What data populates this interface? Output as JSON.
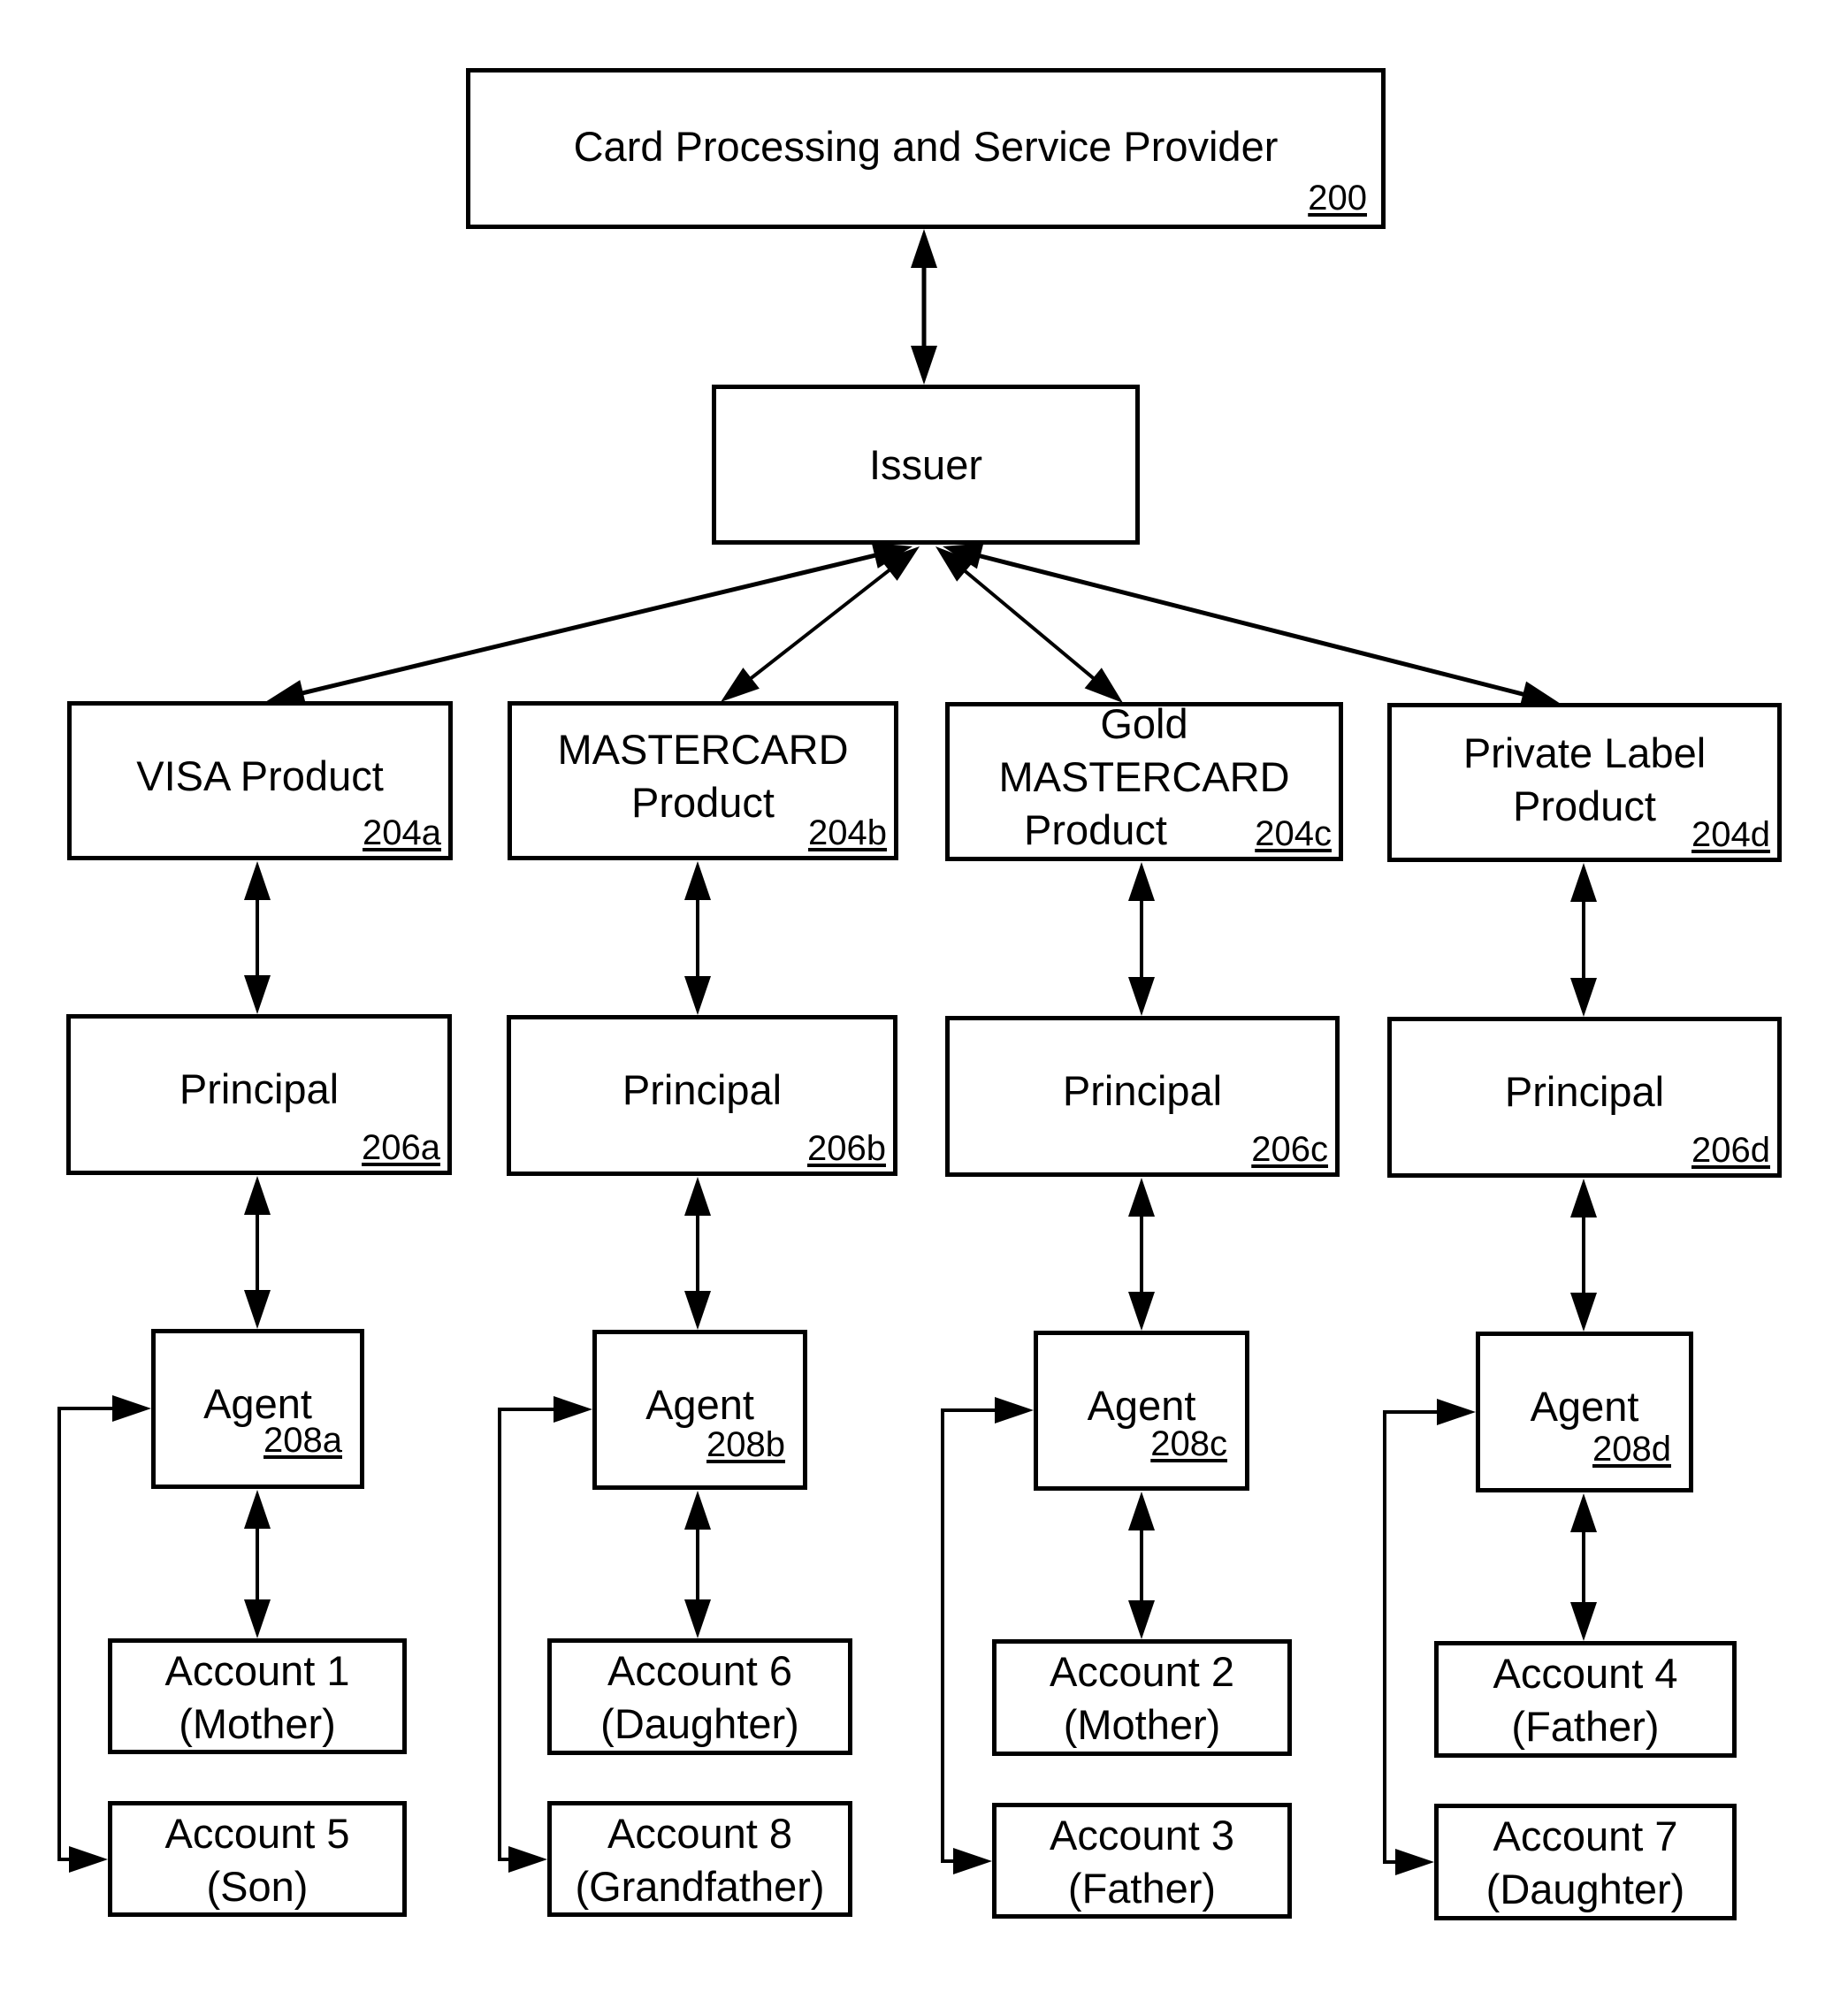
{
  "figure": {
    "provider": {
      "title": "Card Processing and Service Provider",
      "ref": "200"
    },
    "issuer": {
      "title": "Issuer"
    },
    "products": [
      {
        "title_lines": [
          "VISA Product"
        ],
        "ref": "204a"
      },
      {
        "title_lines": [
          "MASTERCARD",
          "Product"
        ],
        "ref": "204b"
      },
      {
        "title_lines": [
          "Gold",
          "MASTERCARD",
          "Product"
        ],
        "ref": "204c"
      },
      {
        "title_lines": [
          "Private Label",
          "Product"
        ],
        "ref": "204d"
      }
    ],
    "principals": [
      {
        "title": "Principal",
        "ref": "206a"
      },
      {
        "title": "Principal",
        "ref": "206b"
      },
      {
        "title": "Principal",
        "ref": "206c"
      },
      {
        "title": "Principal",
        "ref": "206d"
      }
    ],
    "agents": [
      {
        "title": "Agent",
        "ref": "208a"
      },
      {
        "title": "Agent",
        "ref": "208b"
      },
      {
        "title": "Agent",
        "ref": "208c"
      },
      {
        "title": "Agent",
        "ref": "208d"
      }
    ],
    "accounts": [
      [
        {
          "name": "Account 1",
          "holder": "(Mother)"
        },
        {
          "name": "Account 5",
          "holder": "(Son)"
        }
      ],
      [
        {
          "name": "Account 6",
          "holder": "(Daughter)"
        },
        {
          "name": "Account 8",
          "holder": "(Grandfather)"
        }
      ],
      [
        {
          "name": "Account 2",
          "holder": "(Mother)"
        },
        {
          "name": "Account 3",
          "holder": "(Father)"
        }
      ],
      [
        {
          "name": "Account 4",
          "holder": "(Father)"
        },
        {
          "name": "Account 7",
          "holder": "(Daughter)"
        }
      ]
    ],
    "colors": {
      "ink": "#000000",
      "paper": "#ffffff"
    }
  }
}
